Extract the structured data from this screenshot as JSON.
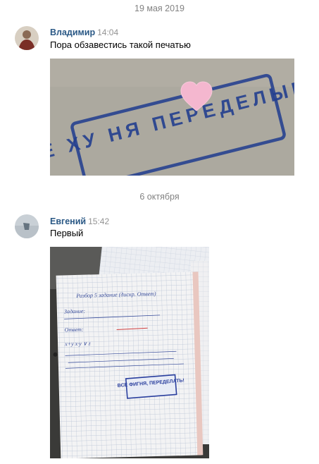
{
  "chat": {
    "messages": [
      {
        "date_separator": "19 мая 2019",
        "author": "Владимир",
        "time": "14:04",
        "text": "Пора обзавестись такой печатью",
        "photo": {
          "stamp_text": "ВСЁ ХУ НЯ ПЕРЕДЕЛЫВАЙ"
        }
      },
      {
        "date_separator": "6 октября",
        "author": "Евгений",
        "time": "15:42",
        "text": "Первый",
        "photo": {
          "handwriting": [
            "Разбор 5 задание (дискр. Ответ)",
            "Задание:",
            "Ответ:",
            "x+y  x·y ∨ z"
          ],
          "stamp_text": "ВСЕ ФИГНЯ, ПЕРЕДЕЛАТЬ!"
        }
      }
    ]
  },
  "colors": {
    "author_link": "#2a5885",
    "meta_gray": "#828282",
    "stamp_blue": "#1f3c8f"
  }
}
